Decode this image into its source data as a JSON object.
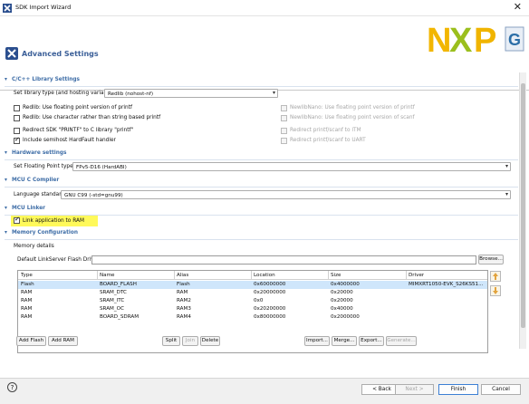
{
  "window": {
    "title": "SDK Import Wizard",
    "close_glyph": "✕"
  },
  "page": {
    "title": "Advanced Settings"
  },
  "sections": {
    "library": {
      "title": "C/C++ Library Settings",
      "set_library_label": "Set library type (and hosting variant)",
      "library_value": "Redlib (nohost-nf)",
      "checkboxes": [
        {
          "label": "Redlib: Use floating point version of printf",
          "checked": false,
          "enabled": true
        },
        {
          "label": "Redlib: Use character rather than string based printf",
          "checked": false,
          "enabled": true
        },
        {
          "label": "Redirect SDK \"PRINTF\" to C library \"printf\"",
          "checked": false,
          "enabled": true
        },
        {
          "label": "Include semihost HardFault handler",
          "checked": true,
          "enabled": true
        }
      ],
      "disabled_checkboxes": [
        {
          "label": "NewlibNano: Use floating point version of printf"
        },
        {
          "label": "NewlibNano: Use floating point version of scanf"
        },
        {
          "label": "Redirect printf/scanf to ITM"
        },
        {
          "label": "Redirect printf/scanf to UART"
        }
      ]
    },
    "hardware": {
      "title": "Hardware settings",
      "fp_label": "Set Floating Point type",
      "fp_value": "FPv5-D16 (HardABI)"
    },
    "compiler": {
      "title": "MCU C Compiler",
      "lang_label": "Language standard",
      "lang_value": "GNU C99 (-std=gnu99)"
    },
    "linker": {
      "title": "MCU Linker",
      "link_ram_label": "Link application to RAM",
      "link_ram_checked": true
    },
    "memory": {
      "title": "Memory Configuration",
      "details_label": "Memory details",
      "flash_driver_label": "Default LinkServer Flash Driver",
      "flash_driver_value": "",
      "browse_label": "Browse...",
      "columns": [
        "Type",
        "Name",
        "Alias",
        "Location",
        "Size",
        "Driver"
      ],
      "rows": [
        [
          "Flash",
          "BOARD_FLASH",
          "Flash",
          "0x60000000",
          "0x4000000",
          "MIMXRT1050-EVK_S26KS51..."
        ],
        [
          "RAM",
          "SRAM_DTC",
          "RAM",
          "0x20000000",
          "0x20000",
          ""
        ],
        [
          "RAM",
          "SRAM_ITC",
          "RAM2",
          "0x0",
          "0x20000",
          ""
        ],
        [
          "RAM",
          "SRAM_OC",
          "RAM3",
          "0x20200000",
          "0x40000",
          ""
        ],
        [
          "RAM",
          "BOARD_SDRAM",
          "RAM4",
          "0x80000000",
          "0x2000000",
          ""
        ]
      ],
      "buttons": {
        "add_flash": "Add Flash",
        "add_ram": "Add RAM",
        "split": "Split",
        "join": "Join",
        "delete": "Delete",
        "import": "Import...",
        "merge": "Merge...",
        "export": "Export...",
        "generate": "Generate..."
      }
    }
  },
  "footer": {
    "help": "?",
    "back": "< Back",
    "next": "Next >",
    "finish": "Finish",
    "cancel": "Cancel"
  },
  "icons": {
    "window": "sdk-import-icon",
    "page": "advanced-settings-icon",
    "logo": "nxp-logo",
    "sdk": "sdk-glyph-icon",
    "up": "move-up-icon",
    "down": "move-down-icon"
  },
  "colors": {
    "accent": "#3f6ea7",
    "highlight": "#fff95a",
    "selected_row": "#cfe6fb",
    "nxp_n": "#f2b600",
    "nxp_x": "#9bbf1d",
    "nxp_p": "#f0b400"
  }
}
